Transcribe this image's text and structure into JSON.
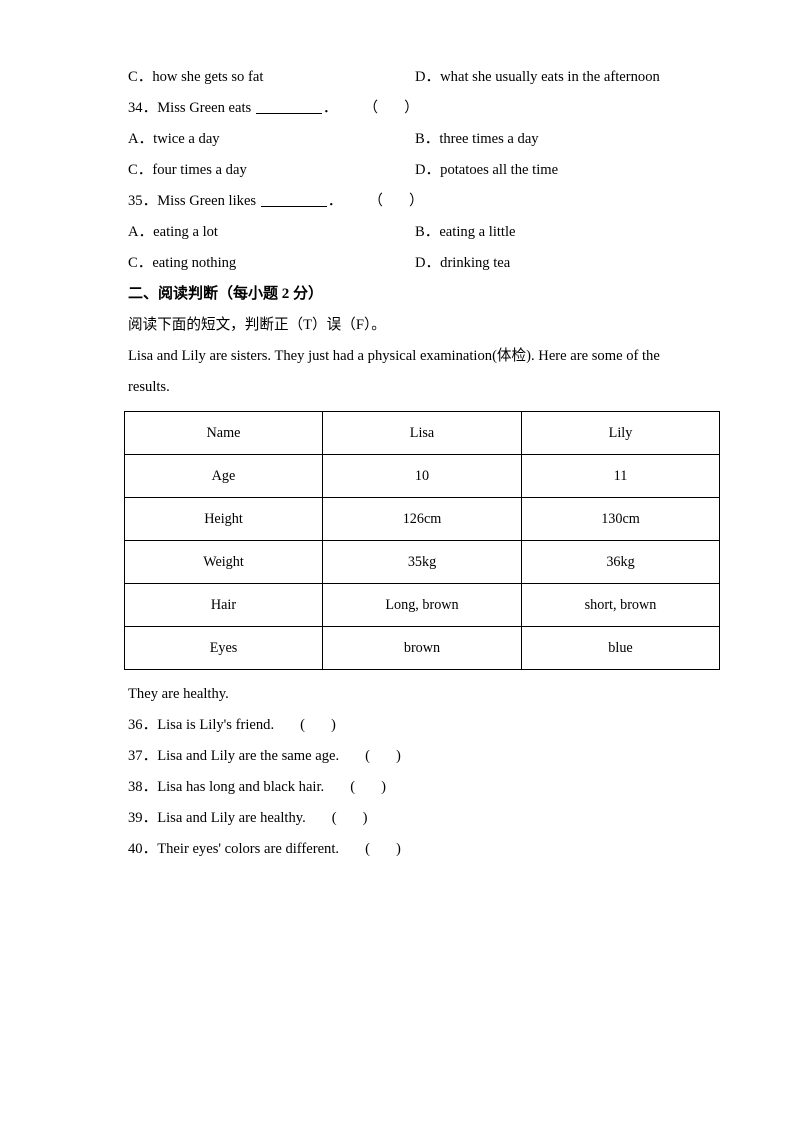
{
  "document": {
    "type": "english-exam-worksheet",
    "page_background": "#ffffff",
    "text_color": "#000000"
  },
  "multiple_choice_tail": {
    "q33_options_continued": [
      {
        "mark": "C．",
        "text": "how she gets so fat"
      },
      {
        "mark": "D．",
        "text": "what she usually eats in the afternoon"
      }
    ],
    "questions": [
      {
        "number": "34．",
        "stem_before": "Miss Green eats ",
        "stem_after": "．",
        "bracket_open": "（",
        "bracket_close": "）",
        "options": [
          {
            "mark": "A．",
            "text": "twice a day"
          },
          {
            "mark": "B．",
            "text": "three times a day"
          },
          {
            "mark": "C．",
            "text": "four times a day"
          },
          {
            "mark": "D．",
            "text": "potatoes all the time"
          }
        ]
      },
      {
        "number": "35．",
        "stem_before": "Miss Green likes ",
        "stem_after": "．",
        "bracket_open": "（",
        "bracket_close": "）",
        "options": [
          {
            "mark": "A．",
            "text": "eating a lot"
          },
          {
            "mark": "B．",
            "text": "eating a little"
          },
          {
            "mark": "C．",
            "text": "eating nothing"
          },
          {
            "mark": "D．",
            "text": "drinking tea"
          }
        ]
      }
    ]
  },
  "section_two": {
    "heading": "二、阅读判断（每小题 2 分）",
    "instruction": "阅读下面的短文，判断正（T）误（F）。",
    "passage_line1": "Lisa and Lily are sisters. They just had a physical examination(体检). Here are some of the",
    "passage_line2": "results.",
    "closing_line": "They are healthy.",
    "table": {
      "rows": [
        {
          "label": "Name",
          "lisa": "Lisa",
          "lily": "Lily"
        },
        {
          "label": "Age",
          "lisa": "10",
          "lily": "11"
        },
        {
          "label": "Height",
          "lisa": "126cm",
          "lily": "130cm"
        },
        {
          "label": "Weight",
          "lisa": "35kg",
          "lily": "36kg"
        },
        {
          "label": "Hair",
          "lisa": "Long, brown",
          "lily": "short, brown"
        },
        {
          "label": "Eyes",
          "lisa": "brown",
          "lily": "blue"
        }
      ]
    },
    "true_false_questions": [
      {
        "number": "36．",
        "text": "Lisa is Lily's friend.",
        "bracket_open": "(",
        "bracket_close": ")"
      },
      {
        "number": "37．",
        "text": "Lisa and Lily are the same age.",
        "bracket_open": "(",
        "bracket_close": ")"
      },
      {
        "number": "38．",
        "text": "Lisa has long and black hair.",
        "bracket_open": "(",
        "bracket_close": ")"
      },
      {
        "number": "39．",
        "text": "Lisa and Lily are healthy.",
        "bracket_open": "(",
        "bracket_close": ")"
      },
      {
        "number": "40．",
        "text": "Their eyes' colors are different.",
        "bracket_open": "(",
        "bracket_close": ")"
      }
    ]
  }
}
